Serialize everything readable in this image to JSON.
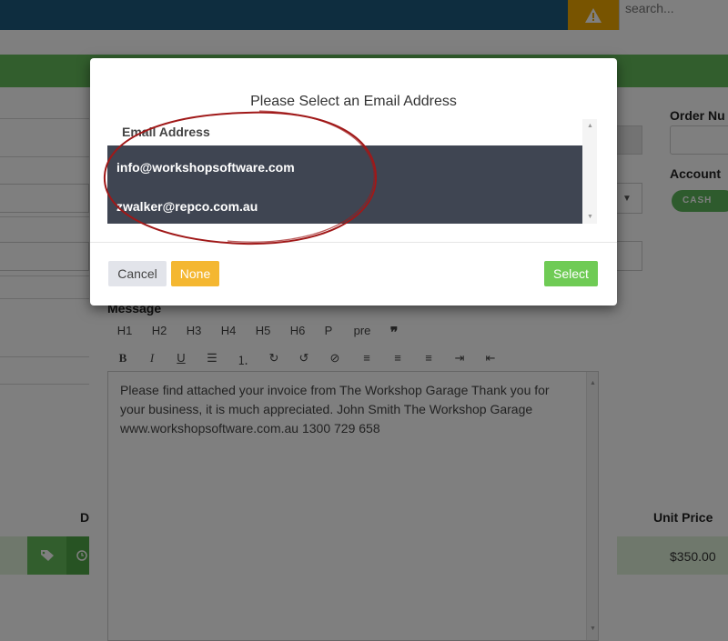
{
  "header": {
    "search_placeholder": "search...",
    "warning_icon": "warning-icon"
  },
  "background": {
    "right_labels": {
      "order_number": "Order Nu",
      "account": "Account"
    },
    "cash_label": "CASH",
    "message_label": "Message",
    "toolbar": {
      "headings": [
        "H1",
        "H2",
        "H3",
        "H4",
        "H5",
        "H6",
        "P",
        "pre",
        "❞"
      ],
      "formatting": [
        "B",
        "I",
        "U",
        "☰",
        "⒈",
        "↻",
        "↺",
        "⊘",
        "≡",
        "≡",
        "≡",
        "⇥",
        "⇤"
      ]
    },
    "message_body": "Please find attached your invoice from The Workshop Garage Thank you for your business, it is much appreciated. John Smith The Workshop Garage www.workshopsoftware.com.au 1300 729 658",
    "table": {
      "col_d": "D",
      "col_unit_price": "Unit Price",
      "row_price": "$350.00"
    }
  },
  "modal": {
    "title": "Please Select an Email Address",
    "list_header": "Email Address",
    "emails": [
      "info@workshopsoftware.com",
      "zwalker@repco.com.au"
    ],
    "buttons": {
      "cancel": "Cancel",
      "none": "None",
      "select": "Select"
    }
  },
  "colors": {
    "topbar": "#1d5b7f",
    "warning": "#f0a800",
    "green_bar": "#64bd5a",
    "list_selected_bg": "#3f4552",
    "none_button": "#f4b731",
    "select_button": "#6fcb55",
    "annotation_circle": "#a01818"
  }
}
